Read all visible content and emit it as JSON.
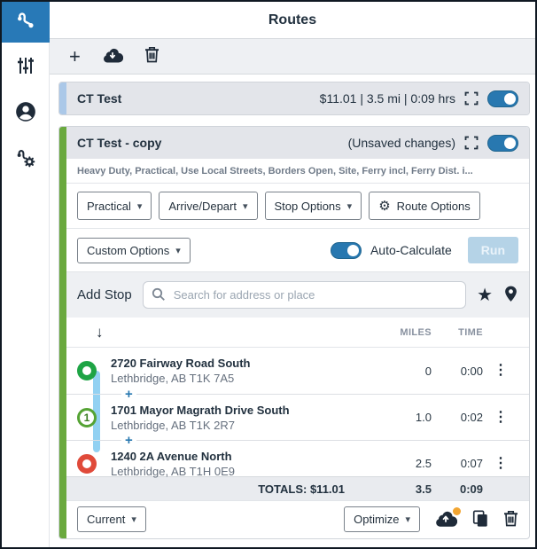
{
  "window": {
    "title": "Routes"
  },
  "rail": {
    "items": [
      {
        "name": "routes",
        "active": true
      },
      {
        "name": "options",
        "active": false
      },
      {
        "name": "account",
        "active": false
      },
      {
        "name": "route-tools",
        "active": false
      }
    ]
  },
  "toolbar": {
    "add_icon": "+",
    "upload_icon": "cloud-download",
    "delete_icon": "trash"
  },
  "routes": [
    {
      "title": "CT Test",
      "summary": "$11.01 | 3.5 mi | 0:09 hrs",
      "accent": "#abc8e8",
      "toggle_on": true
    },
    {
      "title": "CT Test - copy",
      "status": "(Unsaved changes)",
      "accent": "#6aa93e",
      "toggle_on": true
    }
  ],
  "editor": {
    "profile_summary": "Heavy Duty, Practical, Use Local Streets, Borders Open, Site, Ferry incl, Ferry Dist. i...",
    "option_buttons": {
      "routing_type": "Practical",
      "arrive_depart": "Arrive/Depart",
      "stop_options": "Stop Options",
      "route_options": "Route Options"
    },
    "custom_options_label": "Custom Options",
    "auto_calculate_label": "Auto-Calculate",
    "run_label": "Run",
    "add_stop_label": "Add Stop",
    "search": {
      "placeholder": "Search for address or place"
    },
    "columns": {
      "miles": "MILES",
      "time": "TIME"
    },
    "stops": [
      {
        "address": "2720 Fairway Road South",
        "city": "Lethbridge, AB T1K 7A5",
        "miles": "0",
        "time": "0:00",
        "marker": "origin"
      },
      {
        "address": "1701 Mayor Magrath Drive South",
        "city": "Lethbridge, AB T1K 2R7",
        "miles": "1.0",
        "time": "0:02",
        "marker": "1"
      },
      {
        "address": "1240 2A Avenue North",
        "city": "Lethbridge, AB T1H 0E9",
        "miles": "2.5",
        "time": "0:07",
        "marker": "destination"
      }
    ],
    "totals": {
      "label": "TOTALS: $11.01",
      "miles": "3.5",
      "time": "0:09"
    },
    "footer": {
      "current_label": "Current",
      "optimize_label": "Optimize"
    }
  },
  "icons": {
    "caret": "▾",
    "gear": "⚙",
    "plus": "+",
    "down_arrow": "↓",
    "kebab": "⋮",
    "star": "★"
  },
  "colors": {
    "accent_blue": "#2879b7",
    "toggle_blue": "#2878b0",
    "card_accent_light_blue": "#abc8e8",
    "card_accent_green": "#6aa93e",
    "marker_green": "#1ea445",
    "marker_red": "#e04a3a",
    "connector_blue": "#92d1f2",
    "badge_orange": "#f2a531",
    "header_gray": "#e3e5ea"
  }
}
